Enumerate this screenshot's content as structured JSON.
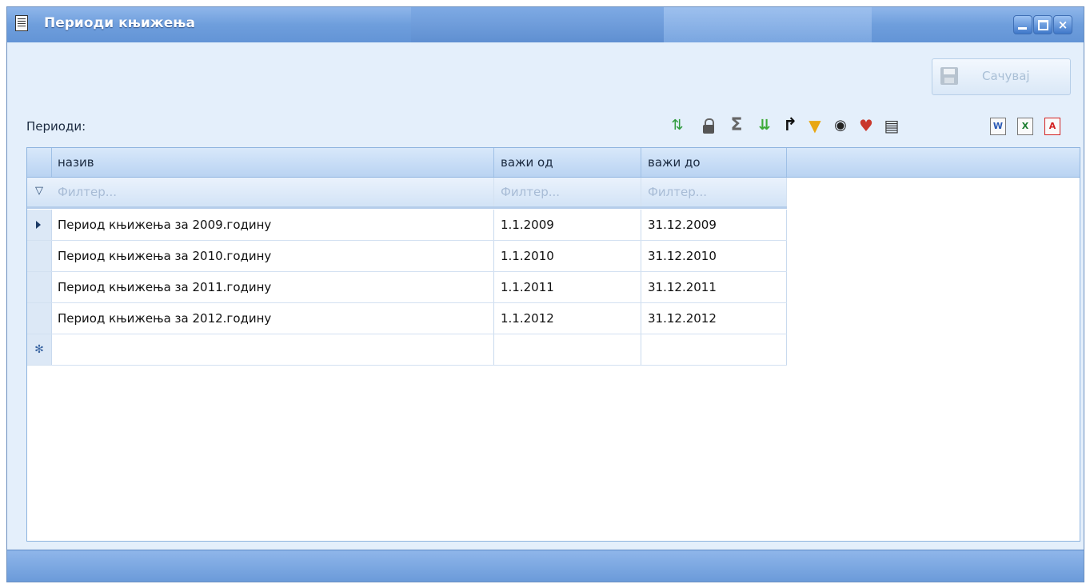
{
  "window": {
    "title": "Периоди књижења",
    "buttons": {
      "minimize": "minimize",
      "maximize": "maximize",
      "close": "×"
    }
  },
  "toolbar": {
    "save_label": "Сачувај",
    "icons": [
      "refresh-icon",
      "lock-icon",
      "sum-icon",
      "expand-icon",
      "goto-icon",
      "filter-icon",
      "eye-icon",
      "heart-icon",
      "print-icon",
      "word-export-icon",
      "excel-export-icon",
      "pdf-export-icon"
    ]
  },
  "section": {
    "label": "Периоди:"
  },
  "grid": {
    "columns": [
      "назив",
      "важи од",
      "важи до"
    ],
    "filter_placeholder": "Филтер...",
    "rows": [
      [
        "Период књижења за 2009.годину",
        "1.1.2009",
        "31.12.2009"
      ],
      [
        "Период књижења за 2010.годину",
        "1.1.2010",
        "31.12.2010"
      ],
      [
        "Период књижења за 2011.годину",
        "1.1.2011",
        "31.12.2011"
      ],
      [
        "Период књижења за 2012.годину",
        "1.1.2012",
        "31.12.2012"
      ]
    ],
    "new_row_marker": "✻"
  },
  "colors": {
    "title_bar": "#6e9edc",
    "window_bg": "#e4effb",
    "grid_border": "#8eb4df"
  }
}
